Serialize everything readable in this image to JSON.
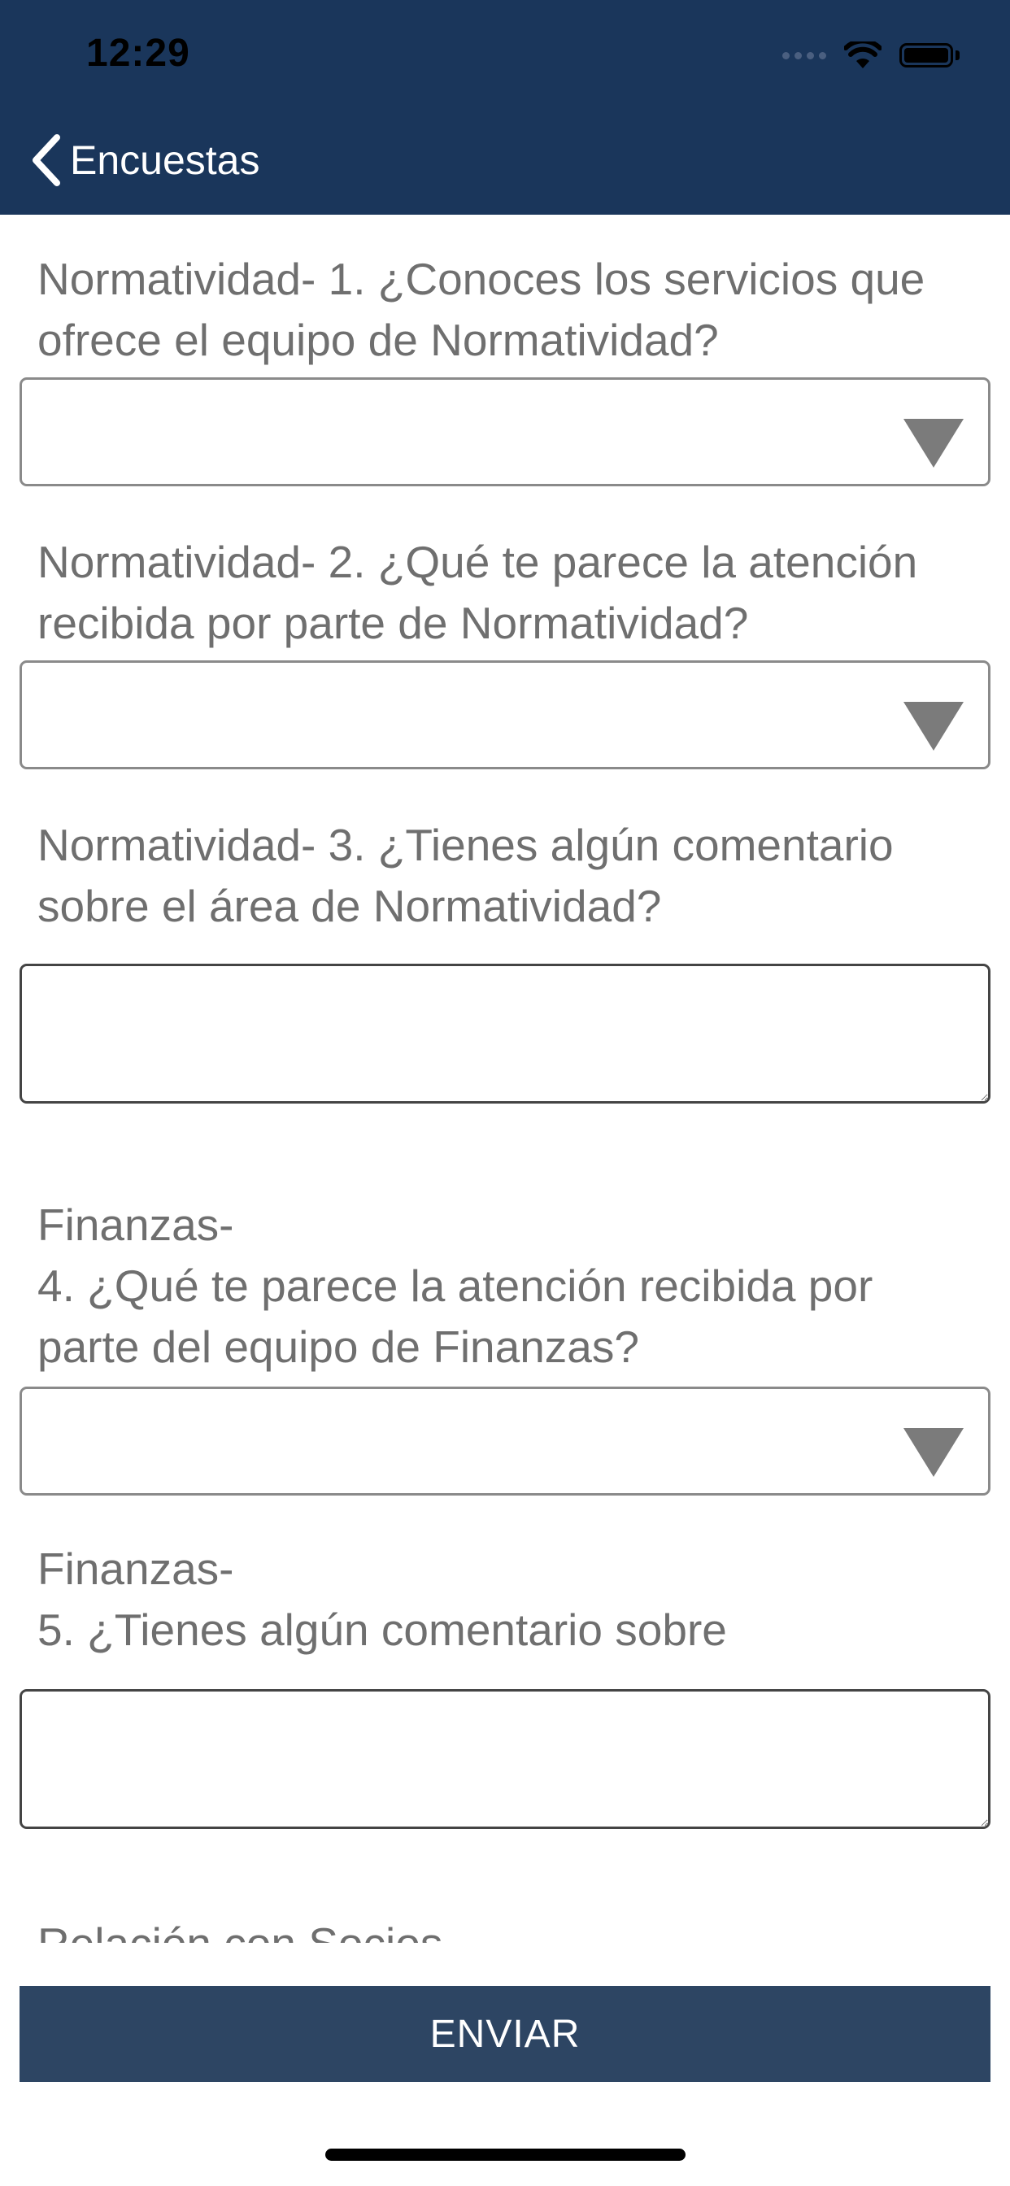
{
  "status_bar": {
    "time": "12:29"
  },
  "nav": {
    "back_label": "Encuestas"
  },
  "questions": [
    {
      "label": "Normatividad- 1. ¿Conoces los servicios que ofrece el equipo de Normatividad?",
      "type": "select",
      "value": ""
    },
    {
      "label": "Normatividad- 2. ¿Qué te parece la atención recibida por parte de Normatividad?",
      "type": "select",
      "value": ""
    },
    {
      "label": "Normatividad- 3. ¿Tienes algún comentario sobre el área de Normatividad?",
      "type": "text",
      "value": ""
    },
    {
      "label": "Finanzas-\n4. ¿Qué te parece la atención recibida por parte del equipo de Finanzas?",
      "type": "select",
      "value": ""
    },
    {
      "label": "Finanzas-\n5. ¿Tienes algún comentario sobre",
      "type": "text",
      "value": ""
    }
  ],
  "partial_question": "Relación con Socios",
  "submit_label": "ENVIAR",
  "colors": {
    "header_bg": "#1a365b",
    "button_bg": "#2d4563",
    "label_text": "#6f6f6f"
  }
}
